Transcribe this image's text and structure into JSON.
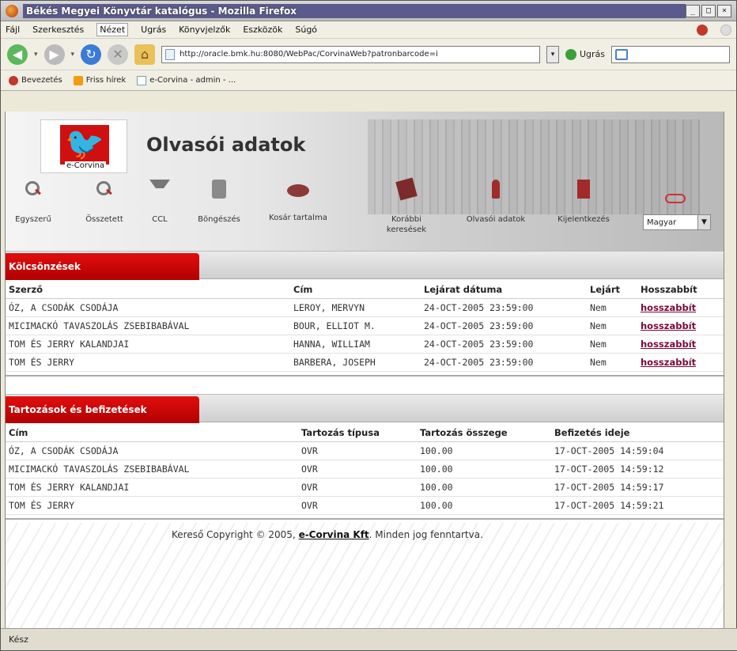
{
  "window": {
    "title": "Békés Megyei Könyvtár katalógus - Mozilla Firefox",
    "buttons": [
      "_",
      "□",
      "×"
    ]
  },
  "menu": [
    "Fájl",
    "Szerkesztés",
    "Nézet",
    "Ugrás",
    "Könyvjelzők",
    "Eszközök",
    "Súgó"
  ],
  "nav": {
    "url": "http://oracle.bmk.hu:8080/WebPac/CorvinaWeb?patronbarcode=i",
    "go_label": "Ugrás"
  },
  "bookmarks": [
    "Bevezetés",
    "Friss hírek",
    "e-Corvina - admin - ..."
  ],
  "page": {
    "logo_text": "e-Corvina",
    "title": "Olvasói adatok",
    "tools": [
      "Egyszerű",
      "Összetett",
      "CCL",
      "Böngészés",
      "Kosár tartalma",
      "Korábbi keresések",
      "Olvasói adatok",
      "Kijelentkezés"
    ],
    "language": "Magyar"
  },
  "loans": {
    "heading": "Kölcsönzések",
    "columns": [
      "Szerző",
      "Cím",
      "Lejárat dátuma",
      "Lejárt",
      "Hosszabbít"
    ],
    "rows": [
      [
        "ÓZ, A CSODÁK CSODÁJA",
        "LEROY, MERVYN",
        "24-OCT-2005 23:59:00",
        "Nem",
        "hosszabbít"
      ],
      [
        "MICIMACKÓ TAVASZOLÁS ZSEBIBABÁVAL",
        "BOUR, ELLIOT M.",
        "24-OCT-2005 23:59:00",
        "Nem",
        "hosszabbít"
      ],
      [
        "TOM ÉS JERRY KALANDJAI",
        "HANNA, WILLIAM",
        "24-OCT-2005 23:59:00",
        "Nem",
        "hosszabbít"
      ],
      [
        "TOM ÉS JERRY",
        "BARBERA, JOSEPH",
        "24-OCT-2005 23:59:00",
        "Nem",
        "hosszabbít"
      ]
    ]
  },
  "debts": {
    "heading": "Tartozások és befizetések",
    "columns": [
      "Cím",
      "Tartozás típusa",
      "Tartozás összege",
      "Befizetés ideje"
    ],
    "rows": [
      [
        "ÓZ, A CSODÁK CSODÁJA",
        "OVR",
        "100.00",
        "17-OCT-2005 14:59:04"
      ],
      [
        "MICIMACKÓ TAVASZOLÁS ZSEBIBABÁVAL",
        "OVR",
        "100.00",
        "17-OCT-2005 14:59:12"
      ],
      [
        "TOM ÉS JERRY KALANDJAI",
        "OVR",
        "100.00",
        "17-OCT-2005 14:59:17"
      ],
      [
        "TOM ÉS JERRY",
        "OVR",
        "100.00",
        "17-OCT-2005 14:59:21"
      ]
    ]
  },
  "footer": {
    "prefix": "Kereső Copyright © 2005,",
    "link": "e-Corvina Kft",
    "suffix": ". Minden jog fenntartva."
  },
  "status": "Kész"
}
